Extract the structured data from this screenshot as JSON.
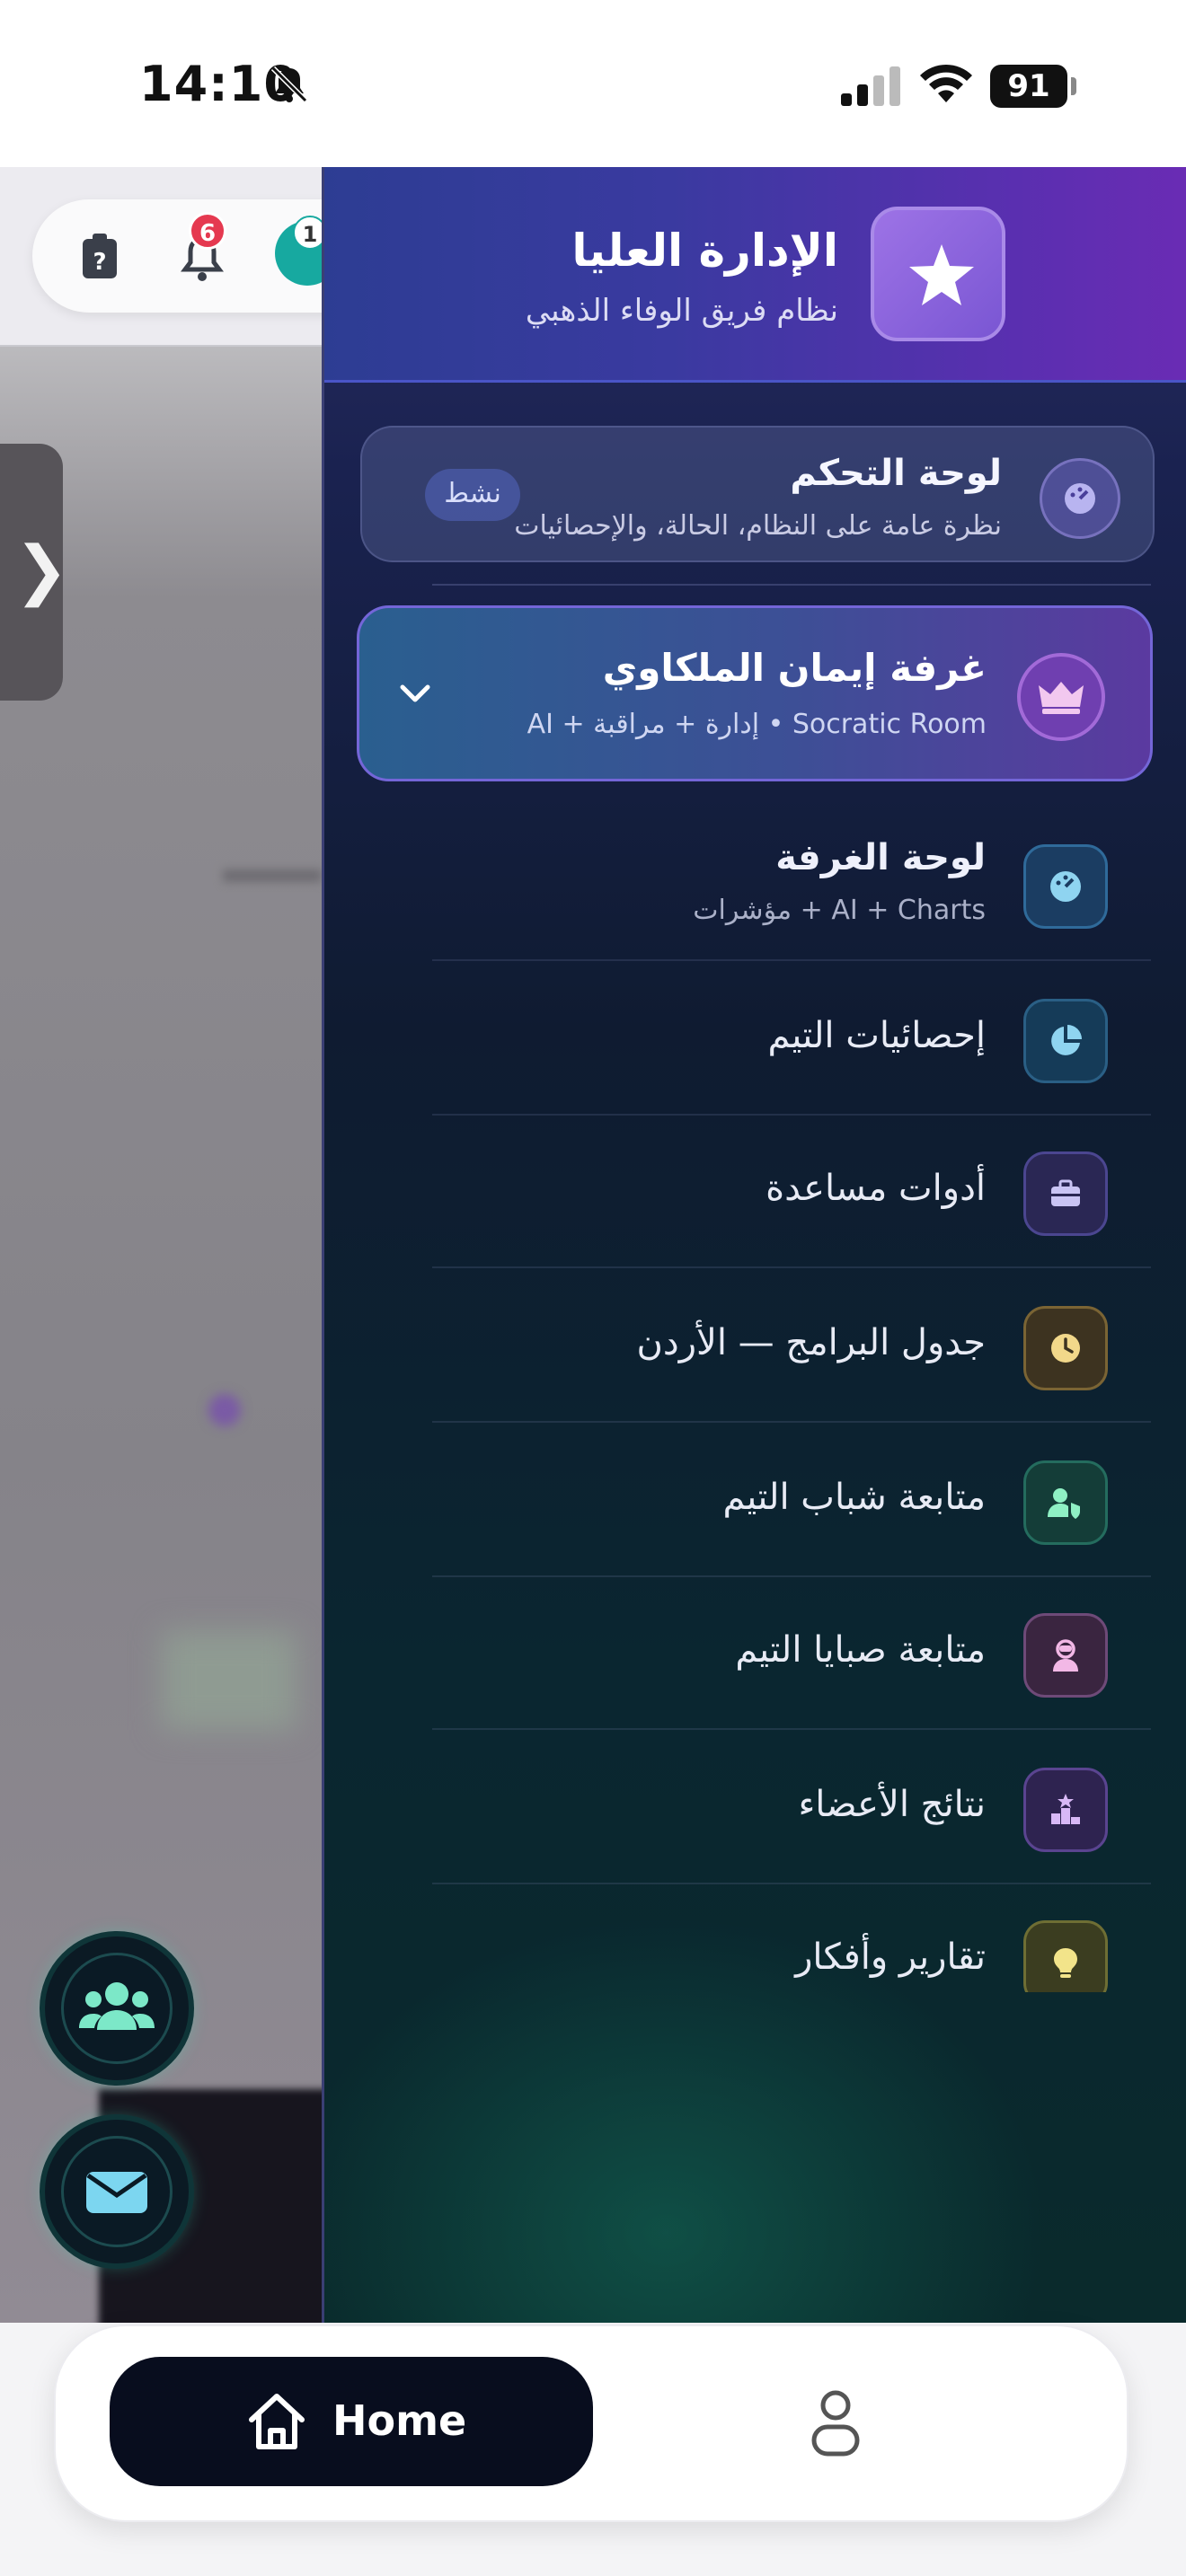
{
  "status": {
    "time": "14:10",
    "battery": "91"
  },
  "background": {
    "notifications_badge": "6",
    "avatar_badge": "1",
    "handle_glyph": "❯"
  },
  "drawer": {
    "title": "الإدارة العليا",
    "subtitle": "نظام فريق الوفاء الذهبي",
    "dashboard": {
      "title": "لوحة التحكم",
      "subtitle": "نظرة عامة على النظام، الحالة، والإحصائيات",
      "badge": "نشط"
    },
    "room": {
      "title": "غرفة إيمان الملكاوي",
      "subtitle": "Socratic Room • إدارة + مراقبة + AI"
    },
    "room_dashboard": {
      "title": "لوحة الغرفة",
      "subtitle": "AI + Charts + مؤشرات"
    },
    "items": [
      {
        "label": "إحصائيات التيم",
        "icon": "pie-chart-icon",
        "color": "#3ab0e0"
      },
      {
        "label": "أدوات مساعدة",
        "icon": "toolbox-icon",
        "color": "#8a7ae0"
      },
      {
        "label": "جدول البرامج — الأردن",
        "icon": "clock-icon",
        "color": "#e8c46a"
      },
      {
        "label": "متابعة شباب التيم",
        "icon": "user-shield-icon",
        "color": "#5ad8a0"
      },
      {
        "label": "متابعة صبايا التيم",
        "icon": "user-astronaut-icon",
        "color": "#e6a0d8"
      },
      {
        "label": "نتائج الأعضاء",
        "icon": "podium-icon",
        "color": "#b07ae6"
      },
      {
        "label": "تقارير وأفكار",
        "icon": "lightbulb-icon",
        "color": "#e8d85a"
      }
    ]
  },
  "bottom_nav": {
    "home_label": "Home"
  }
}
